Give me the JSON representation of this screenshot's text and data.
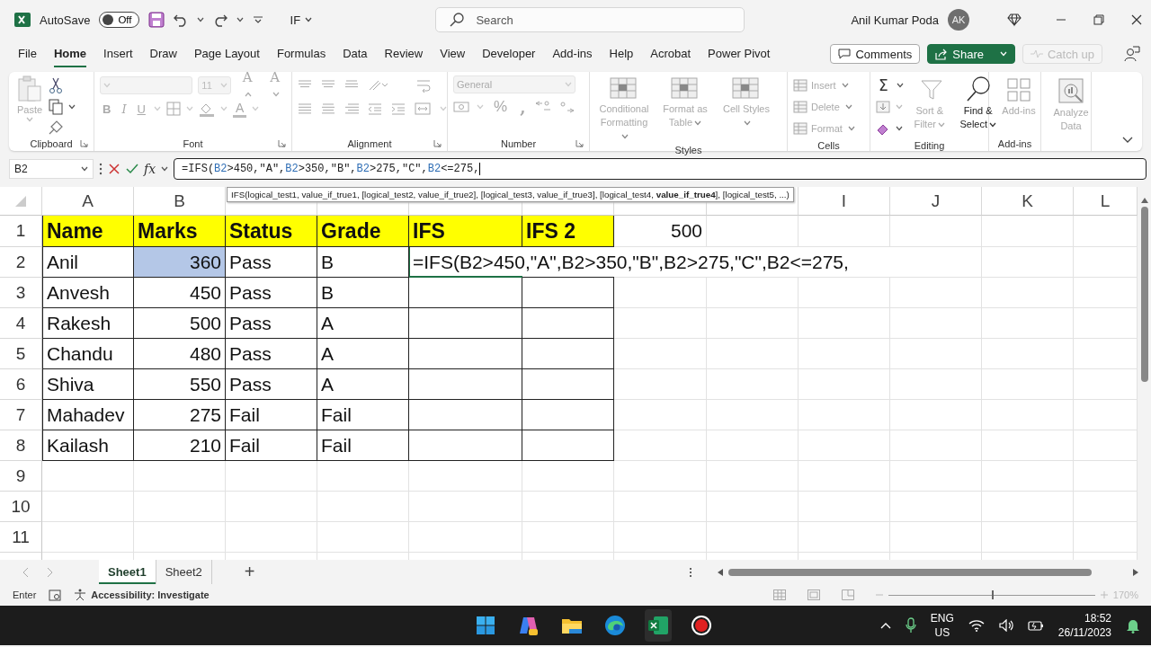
{
  "title_bar": {
    "autosave_label": "AutoSave",
    "autosave_state": "Off",
    "autosave_on": false,
    "file_name": "IF",
    "search_placeholder": "Search",
    "user_name": "Anil Kumar Poda",
    "avatar_initials": "AK"
  },
  "menu_tabs": [
    {
      "label": "File",
      "selected": false
    },
    {
      "label": "Home",
      "selected": true
    },
    {
      "label": "Insert",
      "selected": false
    },
    {
      "label": "Draw",
      "selected": false
    },
    {
      "label": "Page Layout",
      "selected": false
    },
    {
      "label": "Formulas",
      "selected": false
    },
    {
      "label": "Data",
      "selected": false
    },
    {
      "label": "Review",
      "selected": false
    },
    {
      "label": "View",
      "selected": false
    },
    {
      "label": "Developer",
      "selected": false
    },
    {
      "label": "Add-ins",
      "selected": false
    },
    {
      "label": "Help",
      "selected": false
    },
    {
      "label": "Acrobat",
      "selected": false
    },
    {
      "label": "Power Pivot",
      "selected": false
    }
  ],
  "top_buttons": {
    "comments": "Comments",
    "share": "Share",
    "catch_up": "Catch up",
    "catch_up_disabled": true
  },
  "ribbon": {
    "groups": [
      {
        "kind": "clipboard",
        "name": "Clipboard",
        "paste": "Paste",
        "paste_disabled": true
      },
      {
        "kind": "font",
        "name": "Font",
        "font_size": "11",
        "grow": "A",
        "shrink": "A",
        "bold": "B",
        "italic": "I",
        "underline": "U",
        "font_color": "A",
        "disabled": true
      },
      {
        "kind": "alignment",
        "name": "Alignment",
        "disabled": true
      },
      {
        "kind": "number",
        "name": "Number",
        "format": "General",
        "percent": "%",
        "comma": ",",
        "disabled": true
      },
      {
        "kind": "styles",
        "name": "Styles",
        "buttons": [
          {
            "label": "Conditional Formatting",
            "disabled": true
          },
          {
            "label": "Format as Table",
            "disabled": true
          },
          {
            "label": "Cell Styles",
            "disabled": true
          }
        ]
      },
      {
        "kind": "cells",
        "name": "Cells",
        "buttons": [
          {
            "label": "Insert",
            "disabled": true
          },
          {
            "label": "Delete",
            "disabled": true
          },
          {
            "label": "Format",
            "disabled": true
          }
        ]
      },
      {
        "kind": "editing",
        "name": "Editing",
        "sum": "Σ",
        "buttons": [
          {
            "label": "Sort & Filter",
            "disabled": true
          },
          {
            "label": "Find & Select",
            "disabled": false
          }
        ]
      },
      {
        "kind": "addins",
        "name": "Add-ins",
        "buttons": [
          {
            "label": "Add-ins",
            "disabled": true
          }
        ]
      },
      {
        "kind": "analysis",
        "buttons": [
          {
            "label": "Analyze Data",
            "disabled": true
          }
        ]
      }
    ]
  },
  "formula_bar": {
    "name_box": "B2",
    "fx": "fx",
    "formula_parts": [
      {
        "text": "=IFS(",
        "ref": false
      },
      {
        "text": "B2",
        "ref": true
      },
      {
        "text": ">450,\"A\",",
        "ref": false
      },
      {
        "text": "B2",
        "ref": true
      },
      {
        "text": ">350,\"B\",",
        "ref": false
      },
      {
        "text": "B2",
        "ref": true
      },
      {
        "text": ">275,\"C\",",
        "ref": false
      },
      {
        "text": "B2",
        "ref": true
      },
      {
        "text": "<=275,",
        "ref": false
      }
    ]
  },
  "tooltip": "IFS(logical_test1, value_if_true1, [logical_test2, value_if_true2], [logical_test3, value_if_true3], [logical_test4, **value_if_true4**], [logical_test5, ...)",
  "sheet": {
    "columns": [
      {
        "letter": "A"
      },
      {
        "letter": "B"
      },
      {},
      {},
      {},
      {},
      {},
      {},
      {
        "letter": "I"
      },
      {
        "letter": "J"
      },
      {
        "letter": "K"
      },
      {
        "letter": "L"
      }
    ],
    "rows": [
      {
        "label": "1",
        "cells": [
          {
            "text": "Name",
            "kind": "header",
            "selected": false
          },
          {
            "text": "Marks",
            "kind": "header",
            "selected": false
          },
          {
            "text": "Status",
            "kind": "header",
            "selected": false
          },
          {
            "text": "Grade",
            "kind": "header",
            "selected": false
          },
          {
            "text": "IFS",
            "kind": "header",
            "selected": false
          },
          {
            "text": "IFS 2",
            "kind": "header",
            "selected": false
          },
          {
            "text": "500",
            "kind": "value",
            "selected": false
          }
        ]
      },
      {
        "label": "2",
        "cells": [
          {
            "text": "Anil",
            "kind": "text",
            "selected": false
          },
          {
            "text": "360",
            "kind": "number",
            "selected": true
          },
          {
            "text": "Pass",
            "kind": "text",
            "selected": false
          },
          {
            "text": "B",
            "kind": "text",
            "selected": false
          },
          {
            "text": "=IFS(B2>450,\"A\",B2>350,\"B\",B2>275,\"C\",B2<=275,",
            "kind": "formula",
            "selected": false
          }
        ]
      },
      {
        "label": "3",
        "cells": [
          {
            "text": "Anvesh",
            "kind": "text",
            "selected": false
          },
          {
            "text": "450",
            "kind": "number",
            "selected": false
          },
          {
            "text": "Pass",
            "kind": "text",
            "selected": false
          },
          {
            "text": "B",
            "kind": "text",
            "selected": false
          },
          {
            "kind": "blank",
            "selected": false
          },
          {
            "kind": "blank",
            "selected": false
          }
        ]
      },
      {
        "label": "4",
        "cells": [
          {
            "text": "Rakesh",
            "kind": "text",
            "selected": false
          },
          {
            "text": "500",
            "kind": "number",
            "selected": false
          },
          {
            "text": "Pass",
            "kind": "text",
            "selected": false
          },
          {
            "text": "A",
            "kind": "text",
            "selected": false
          },
          {
            "kind": "blank",
            "selected": false
          },
          {
            "kind": "blank",
            "selected": false
          }
        ]
      },
      {
        "label": "5",
        "cells": [
          {
            "text": "Chandu",
            "kind": "text",
            "selected": false
          },
          {
            "text": "480",
            "kind": "number",
            "selected": false
          },
          {
            "text": "Pass",
            "kind": "text",
            "selected": false
          },
          {
            "text": "A",
            "kind": "text",
            "selected": false
          },
          {
            "kind": "blank",
            "selected": false
          },
          {
            "kind": "blank",
            "selected": false
          }
        ]
      },
      {
        "label": "6",
        "cells": [
          {
            "text": "Shiva",
            "kind": "text",
            "selected": false
          },
          {
            "text": "550",
            "kind": "number",
            "selected": false
          },
          {
            "text": "Pass",
            "kind": "text",
            "selected": false
          },
          {
            "text": "A",
            "kind": "text",
            "selected": false
          },
          {
            "kind": "blank",
            "selected": false
          },
          {
            "kind": "blank",
            "selected": false
          }
        ]
      },
      {
        "label": "7",
        "cells": [
          {
            "text": "Mahadev",
            "kind": "text",
            "selected": false
          },
          {
            "text": "275",
            "kind": "number",
            "selected": false
          },
          {
            "text": "Fail",
            "kind": "text",
            "selected": false
          },
          {
            "text": "Fail",
            "kind": "text",
            "selected": false
          },
          {
            "kind": "blank",
            "selected": false
          },
          {
            "kind": "blank",
            "selected": false
          }
        ]
      },
      {
        "label": "8",
        "cells": [
          {
            "text": "Kailash",
            "kind": "text",
            "selected": false
          },
          {
            "text": "210",
            "kind": "number",
            "selected": false
          },
          {
            "text": "Fail",
            "kind": "text",
            "selected": false
          },
          {
            "text": "Fail",
            "kind": "text",
            "selected": false
          },
          {
            "kind": "blank",
            "selected": false
          },
          {
            "kind": "blank",
            "selected": false
          }
        ]
      },
      {
        "label": "9"
      },
      {
        "label": "10"
      },
      {
        "label": "11"
      }
    ]
  },
  "sheet_tabs": [
    {
      "label": "Sheet1",
      "selected": true
    },
    {
      "label": "Sheet2",
      "selected": false
    }
  ],
  "add_sheet": "+",
  "status_bar": {
    "mode": "Enter",
    "accessibility": "Accessibility: Investigate",
    "zoom": "170%",
    "zoom_slider": {
      "level": 0.5
    }
  },
  "taskbar": {
    "language": "ENG",
    "region": "US",
    "time": "18:52",
    "date": "26/11/2023"
  }
}
